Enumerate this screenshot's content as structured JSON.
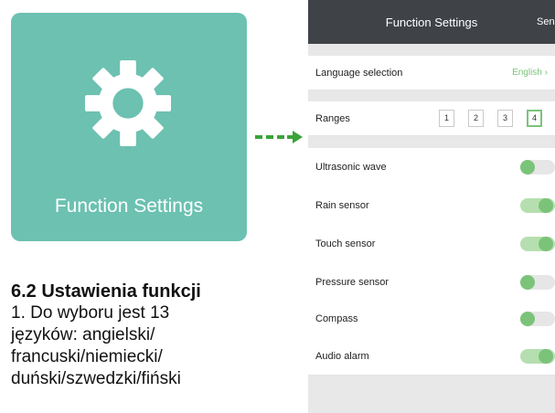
{
  "tile": {
    "label": "Function Settings",
    "icon": "gear-icon",
    "background_color": "#6cc1b1"
  },
  "arrow": {
    "icon": "dashed-arrow-right-icon",
    "color": "#3aa33a"
  },
  "doc": {
    "heading": "6.2 Ustawienia funkcji",
    "lines": [
      "1. Do wyboru jest 13",
      "języków: angielski/",
      "francuski/niemiecki/",
      "duński/szwedzki/fiński"
    ]
  },
  "phone": {
    "title": "Function Settings",
    "header_action": "Send",
    "language": {
      "label": "Language selection",
      "value": "English",
      "chevron": "chevron-right-icon"
    },
    "ranges": {
      "label": "Ranges",
      "options": [
        "1",
        "2",
        "3",
        "4"
      ],
      "selected": "4"
    },
    "toggles": [
      {
        "label": "Ultrasonic wave",
        "on": false
      },
      {
        "label": "Rain sensor",
        "on": true
      },
      {
        "label": "Touch sensor",
        "on": true
      },
      {
        "label": "Pressure sensor",
        "on": false
      },
      {
        "label": "Compass",
        "on": false
      },
      {
        "label": "Audio alarm",
        "on": true
      }
    ],
    "accent_color": "#7cc37a",
    "header_color": "#3f4348"
  }
}
